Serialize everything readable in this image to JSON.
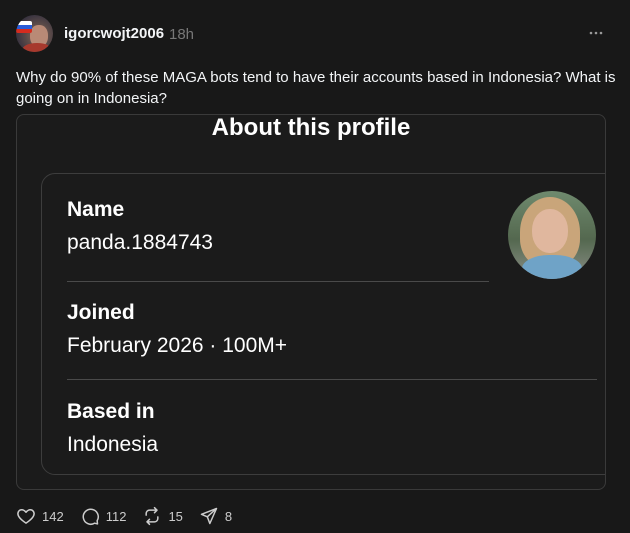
{
  "post": {
    "username": "igorcwojt2006",
    "time": "18h",
    "text": "Why do 90% of these MAGA bots tend to have their accounts based in Indonesia? What is going on in Indonesia?"
  },
  "embed": {
    "title": "About this profile",
    "fields": [
      {
        "label": "Name",
        "value": "panda.1884743"
      },
      {
        "label": "Joined",
        "value": "February 2026 · 100M+"
      },
      {
        "label": "Based in",
        "value": "Indonesia"
      }
    ]
  },
  "actions": {
    "likes": "142",
    "replies": "112",
    "reposts": "15",
    "shares": "8"
  },
  "icons": {
    "more": "more-horizontal-icon",
    "like": "heart-icon",
    "reply": "comment-icon",
    "repost": "repost-icon",
    "share": "send-icon"
  },
  "colors": {
    "background": "#181818",
    "text": "#f3f5f7",
    "muted": "#777777",
    "border": "#3a3a3a"
  }
}
